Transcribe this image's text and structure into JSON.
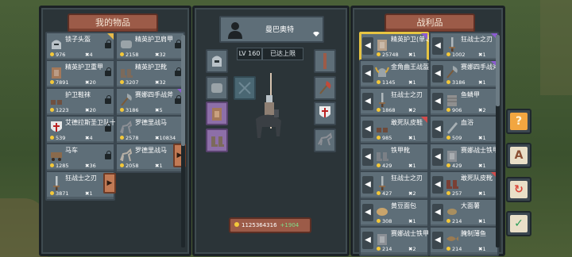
{
  "left_panel": {
    "title": "我的物品",
    "items": [
      {
        "name": "锁子头盔",
        "price": "976",
        "qty": "4",
        "tri": "y",
        "lock": true,
        "icon_color": "#b9c2c8",
        "icon": "helmet-icon"
      },
      {
        "name": "精英护卫肩甲",
        "price": "2158",
        "qty": "32",
        "tri": "",
        "lock": true,
        "icon_color": "#9aa3a8",
        "icon": "pauldron-icon"
      },
      {
        "name": "精英护卫重甲",
        "price": "7891",
        "qty": "20",
        "tri": "",
        "lock": true,
        "icon_color": "#a3785a",
        "icon": "armor-icon"
      },
      {
        "name": "精英护卫靴",
        "price": "3207",
        "qty": "32",
        "tri": "",
        "lock": true,
        "icon_color": "#7c6a5b",
        "icon": "boots-icon"
      },
      {
        "name": "护卫鞋袜",
        "price": "1223",
        "qty": "20",
        "tri": "",
        "lock": true,
        "icon_color": "#6f5040",
        "icon": "shoes-icon"
      },
      {
        "name": "赛娜四手战斧",
        "price": "3186",
        "qty": "5",
        "tri": "c",
        "lock": true,
        "icon_color": "#9ea7ab",
        "icon": "axe-icon"
      },
      {
        "name": "艾德拉斯圣卫队十字盾",
        "price": "539",
        "qty": "4",
        "tri": "",
        "lock": true,
        "icon_color": "#e8e8e8",
        "icon": "cross-shield-icon"
      },
      {
        "name": "罗德里战马",
        "price": "2578",
        "qty": "10834",
        "tri": "",
        "lock": false,
        "icon_color": "#8c8f95",
        "icon": "horse-icon"
      },
      {
        "name": "马车",
        "price": "1285",
        "qty": "36",
        "tri": "",
        "lock": true,
        "icon_color": "#8a6a4c",
        "icon": "cart-icon"
      },
      {
        "name": "罗德里战马",
        "price": "2058",
        "qty": "1",
        "tri": "",
        "lock": false,
        "icon_color": "#b7b0a6",
        "icon": "horse-icon"
      },
      {
        "name": "狂战士之刃",
        "price": "3871",
        "qty": "1",
        "tri": "",
        "lock": false,
        "icon_color": "#c0c8cc",
        "icon": "sword-icon"
      }
    ]
  },
  "center_panel": {
    "hero_name": "曼巴奥特",
    "level": "LV 160",
    "level_status": "已达上限",
    "gold": "1125364316",
    "gold_delta": "+1904"
  },
  "right_panel": {
    "title": "战利品",
    "items": [
      {
        "name": "精英护卫(单导弹)甲",
        "price": "25748",
        "qty": "1",
        "tri": "c",
        "selected": true,
        "icon_color": "#b6a08a",
        "icon": "armor-icon"
      },
      {
        "name": "狂战士之刃",
        "price": "1002",
        "qty": "1",
        "tri": "c",
        "selected": false,
        "icon_color": "#b0b8bc",
        "icon": "sword-icon"
      },
      {
        "name": "金角曲王战盔",
        "price": "1145",
        "qty": "1",
        "tri": "",
        "selected": false,
        "icon_color": "#d9a93b",
        "icon": "horned-helmet-icon"
      },
      {
        "name": "赛娜四手战斧",
        "price": "3186",
        "qty": "1",
        "tri": "c",
        "selected": false,
        "icon_color": "#9ea7ab",
        "icon": "axe-icon"
      },
      {
        "name": "狂战士之刃",
        "price": "1868",
        "qty": "2",
        "tri": "",
        "selected": false,
        "icon_color": "#b0b8bc",
        "icon": "sword-icon"
      },
      {
        "name": "鱼鳞甲",
        "price": "906",
        "qty": "2",
        "tri": "",
        "selected": false,
        "icon_color": "#8f8f8f",
        "icon": "scale-armor-icon"
      },
      {
        "name": "敢死队皮鞋",
        "price": "985",
        "qty": "1",
        "tri": "r",
        "selected": false,
        "icon_color": "#6e4a3a",
        "icon": "shoes-icon"
      },
      {
        "name": "血浴",
        "price": "509",
        "qty": "1",
        "tri": "",
        "selected": false,
        "icon_color": "#a8b0b4",
        "icon": "blade-icon"
      },
      {
        "name": "铁甲靴",
        "price": "429",
        "qty": "1",
        "tri": "",
        "selected": false,
        "icon_color": "#7b8086",
        "icon": "boots-icon"
      },
      {
        "name": "赛娜战士铁甲",
        "price": "429",
        "qty": "1",
        "tri": "",
        "selected": false,
        "icon_color": "#8a8f95",
        "icon": "armor-icon"
      },
      {
        "name": "狂战士之刃",
        "price": "427",
        "qty": "2",
        "tri": "",
        "selected": false,
        "icon_color": "#b0b8bc",
        "icon": "sword-icon"
      },
      {
        "name": "敢死队皮靴",
        "price": "257",
        "qty": "1",
        "tri": "r",
        "selected": false,
        "icon_color": "#7a3f34",
        "icon": "boots-icon"
      },
      {
        "name": "黄豆面包",
        "price": "308",
        "qty": "1",
        "tri": "",
        "selected": false,
        "icon_color": "#c9a46b",
        "icon": "bread-icon"
      },
      {
        "name": "大面薯",
        "price": "214",
        "qty": "1",
        "tri": "",
        "selected": false,
        "icon_color": "#a88e5f",
        "icon": "potato-icon"
      },
      {
        "name": "赛娜战士铁甲",
        "price": "214",
        "qty": "2",
        "tri": "",
        "selected": false,
        "icon_color": "#8a8f95",
        "icon": "armor-icon"
      },
      {
        "name": "腌制薄鱼",
        "price": "214",
        "qty": "1",
        "tri": "",
        "selected": false,
        "icon_color": "#9a7b52",
        "icon": "fish-icon"
      }
    ]
  },
  "side_buttons": [
    {
      "label": "?",
      "name": "help-button",
      "color": "#e8a233"
    },
    {
      "label": "A",
      "name": "auto-sell-button",
      "color": "#8b5034"
    },
    {
      "label": "↻",
      "name": "refresh-button",
      "color": "#d9463a"
    },
    {
      "label": "✓",
      "name": "confirm-button",
      "color": "#2a9e58"
    }
  ]
}
